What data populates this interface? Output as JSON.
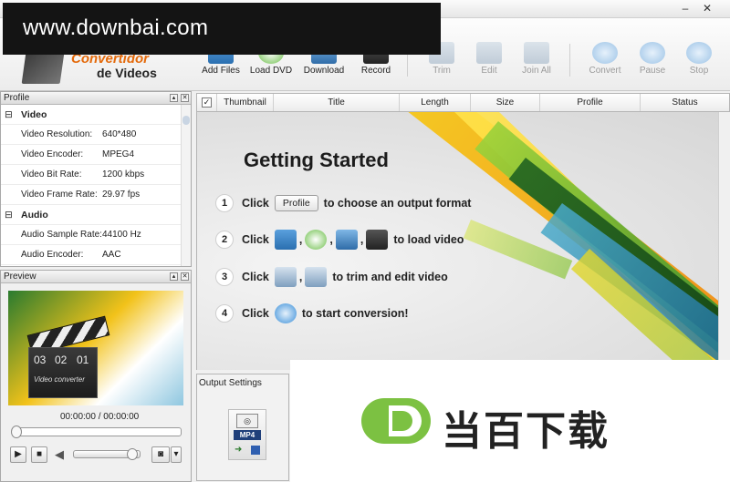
{
  "watermark_top": "www.downbai.com",
  "logo": {
    "line1": "Convertidor",
    "line2": "de Videos"
  },
  "toolbar": {
    "add_files": "Add Files",
    "load_dvd": "Load DVD",
    "download": "Download",
    "record": "Record",
    "trim": "Trim",
    "edit": "Edit",
    "join_all": "Join All",
    "convert": "Convert",
    "pause": "Pause",
    "stop": "Stop"
  },
  "profile_panel": {
    "title": "Profile",
    "video_group": "Video",
    "audio_group": "Audio",
    "rows": [
      {
        "key": "Video Resolution:",
        "value": "640*480"
      },
      {
        "key": "Video Encoder:",
        "value": "MPEG4"
      },
      {
        "key": "Video Bit Rate:",
        "value": "1200 kbps"
      },
      {
        "key": "Video Frame Rate:",
        "value": "29.97 fps"
      },
      {
        "key": "Audio Sample Rate:",
        "value": "44100 Hz"
      },
      {
        "key": "Audio Encoder:",
        "value": "AAC"
      }
    ]
  },
  "preview_panel": {
    "title": "Preview",
    "time": "00:00:00 / 00:00:00",
    "clapper_digits": [
      "03",
      "02",
      "01"
    ],
    "clapper_caption": "Video converter"
  },
  "file_list": {
    "columns": [
      "Thumbnail",
      "Title",
      "Length",
      "Size",
      "Profile",
      "Status"
    ]
  },
  "getting_started": {
    "title": "Getting Started",
    "step1_num": "1",
    "step1_click": "Click",
    "step1_button": "Profile",
    "step1_text": "to choose an output format",
    "step2_num": "2",
    "step2_click": "Click",
    "step2_text": "to load video",
    "step3_num": "3",
    "step3_click": "Click",
    "step3_text": "to trim and edit video",
    "step4_num": "4",
    "step4_click": "Click",
    "step4_text": "to start conversion!"
  },
  "output_settings": {
    "title": "Output Settings",
    "format": "MP4"
  },
  "site_watermark": {
    "letter": "D",
    "text": "当百下载"
  },
  "colors": {
    "accent_green": "#7cc142",
    "logo_orange": "#e46a0b"
  }
}
